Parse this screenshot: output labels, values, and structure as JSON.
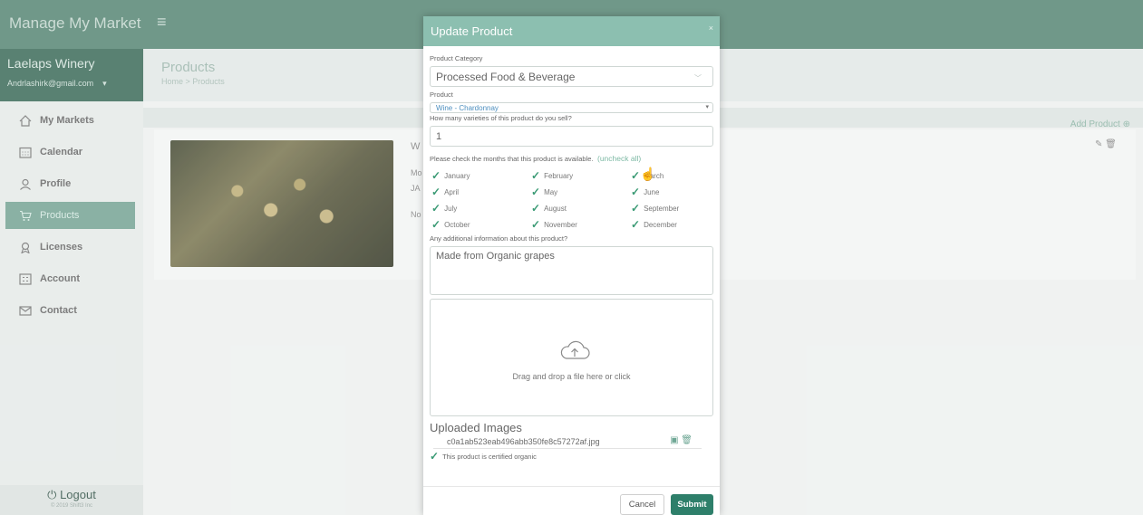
{
  "app": {
    "brand": "Manage My Market",
    "menu_icon": "hamburger-icon"
  },
  "account": {
    "name": "Laelaps Winery",
    "email": "Andrlashirk@gmail.com",
    "caret": "▾"
  },
  "sidebar": {
    "items": [
      {
        "label": "My Markets",
        "icon": "home-icon"
      },
      {
        "label": "Calendar",
        "icon": "calendar-icon"
      },
      {
        "label": "Profile",
        "icon": "user-icon"
      },
      {
        "label": "Products",
        "icon": "cart-icon",
        "active": true
      },
      {
        "label": "Licenses",
        "icon": "license-icon"
      },
      {
        "label": "Account",
        "icon": "account-icon"
      },
      {
        "label": "Contact",
        "icon": "mail-icon"
      }
    ],
    "logout": "Logout",
    "copyright": "© 2019 Shift3 Inc"
  },
  "page": {
    "title": "Products",
    "breadcrumb": "Home > Products",
    "add_product": "Add Product ⊕",
    "card_heading_fragment": "W",
    "card_line1": "Mo",
    "card_line2": "JA",
    "card_line3": "No"
  },
  "modal": {
    "title": "Update Product",
    "close": "×",
    "category_label": "Product Category",
    "category_value": "Processed Food & Beverage",
    "product_label": "Product",
    "product_value": "Wine - Chardonnay",
    "varieties_label": "How many varieties of this product do you sell?",
    "varieties_value": "1",
    "months_label": "Please check the months that this product is available.",
    "uncheck_all": "(uncheck all)",
    "months": [
      "January",
      "February",
      "March",
      "April",
      "May",
      "June",
      "July",
      "August",
      "September",
      "October",
      "November",
      "December"
    ],
    "additional_label": "Any additional information about this product?",
    "additional_value": "Made from Organic grapes",
    "dropzone_text": "Drag and drop a file here or click",
    "uploaded_title": "Uploaded Images",
    "uploaded_file": "c0a1ab523eab496abb350fe8c57272af.jpg",
    "organic_label": "This product is certified organic",
    "cancel": "Cancel",
    "submit": "Submit"
  },
  "colors": {
    "topbar": "#5d8a79",
    "accent": "#2e7f6a",
    "modal_header": "#8cbfb0",
    "check": "#3a9a74"
  }
}
